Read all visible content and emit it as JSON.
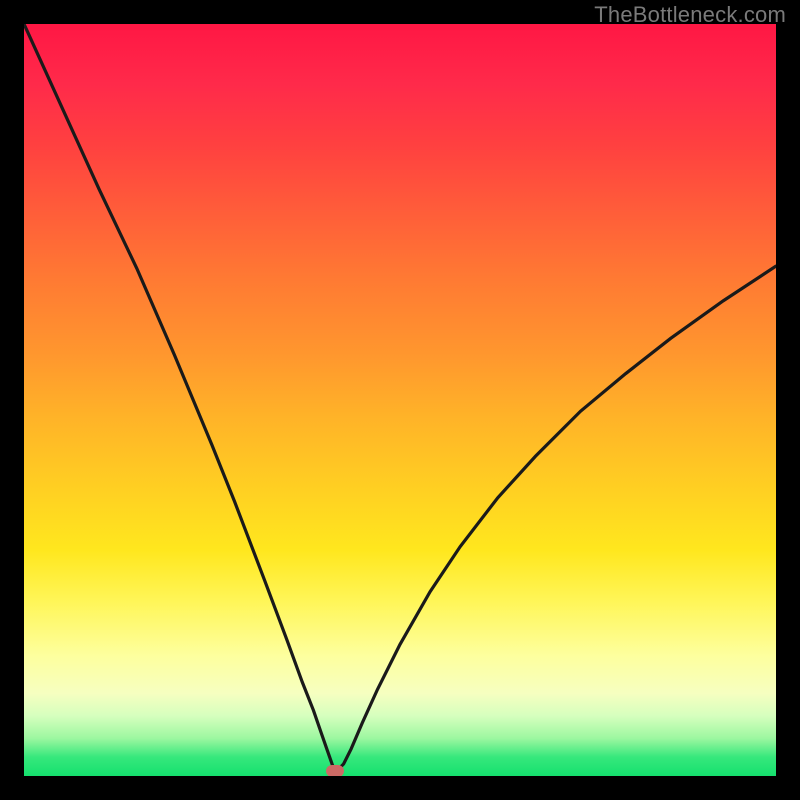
{
  "watermark": "TheBottleneck.com",
  "colors": {
    "frame": "#000000",
    "curve_stroke": "#1a1a1a",
    "marker_fill": "#cc6a65"
  },
  "chart_data": {
    "type": "line",
    "title": "",
    "xlabel": "",
    "ylabel": "",
    "xlim": [
      0,
      100
    ],
    "ylim": [
      0,
      100
    ],
    "grid": false,
    "series": [
      {
        "name": "curve",
        "x": [
          0,
          5,
          10,
          15,
          20,
          25,
          28,
          32,
          35,
          37,
          38.5,
          39.5,
          40.3,
          41,
          41.3,
          41.7,
          42.5,
          43.5,
          45,
          47,
          50,
          54,
          58,
          63,
          68,
          74,
          80,
          86,
          93,
          100
        ],
        "values": [
          100,
          89,
          78,
          67.5,
          56,
          44,
          36.5,
          26,
          18,
          12.5,
          8.7,
          5.8,
          3.5,
          1.5,
          0.7,
          0.8,
          1.6,
          3.6,
          7.1,
          11.5,
          17.5,
          24.5,
          30.5,
          37,
          42.5,
          48.5,
          53.5,
          58.2,
          63.2,
          67.8
        ]
      },
      {
        "name": "min-marker",
        "x": [
          41.3
        ],
        "values": [
          0.6
        ]
      }
    ],
    "gradient_stops": [
      {
        "pos": 0,
        "hex": "#ff1744"
      },
      {
        "pos": 50,
        "hex": "#ffb228"
      },
      {
        "pos": 80,
        "hex": "#fff65a"
      },
      {
        "pos": 97,
        "hex": "#36e87c"
      },
      {
        "pos": 100,
        "hex": "#15e06e"
      }
    ]
  }
}
